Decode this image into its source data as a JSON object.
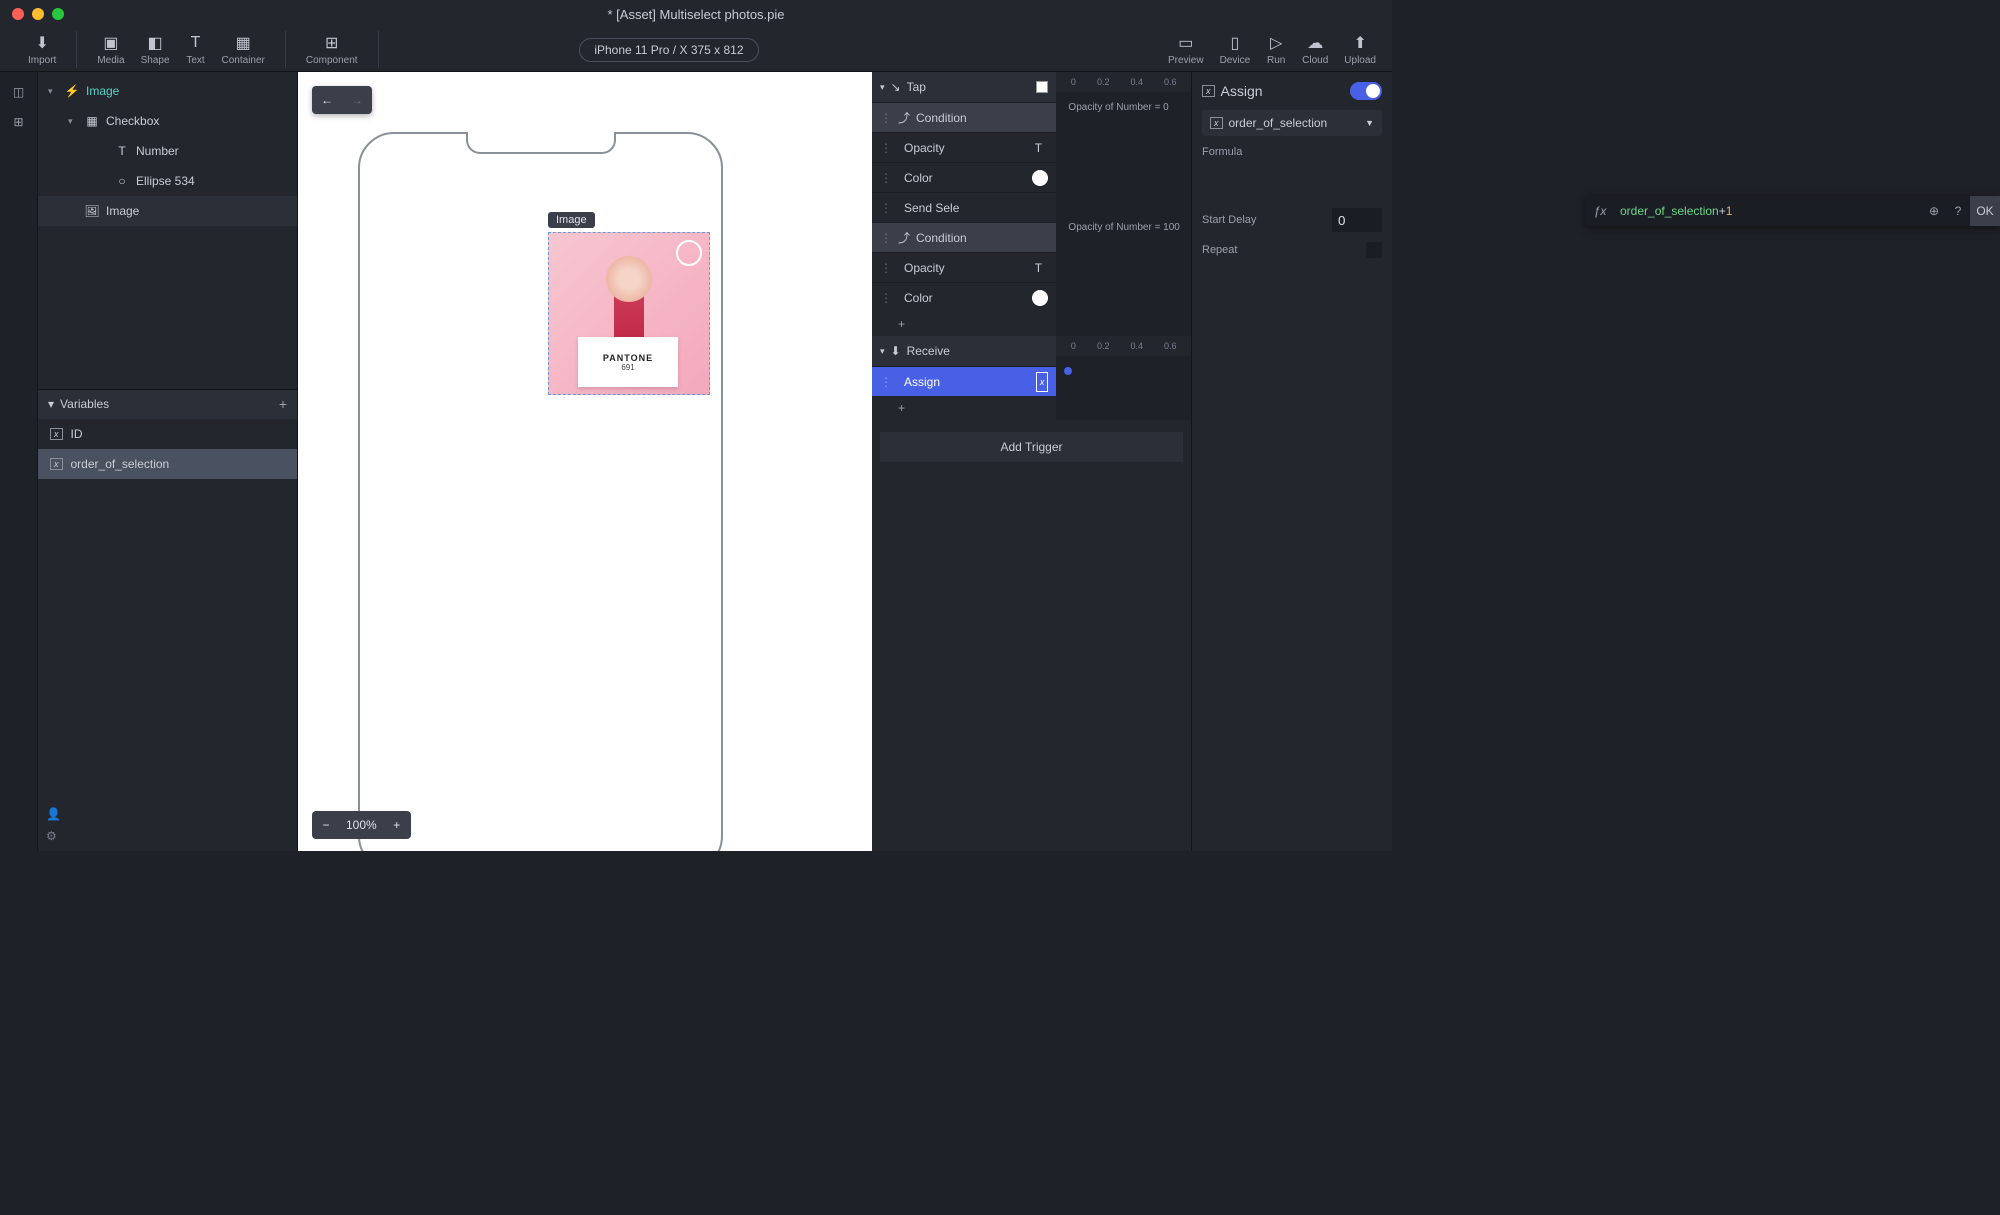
{
  "titlebar": {
    "title": "* [Asset] Multiselect photos.pie"
  },
  "toolbar": {
    "import": "Import",
    "media": "Media",
    "shape": "Shape",
    "text": "Text",
    "container": "Container",
    "component": "Component",
    "device_pill": "iPhone 11 Pro / X  375 x 812",
    "preview": "Preview",
    "device": "Device",
    "run": "Run",
    "cloud": "Cloud",
    "upload": "Upload"
  },
  "tree": {
    "items": [
      {
        "label": "Image",
        "icon": "bolt",
        "level": 0,
        "chev": "▾",
        "accent": true
      },
      {
        "label": "Checkbox",
        "icon": "grid",
        "level": 1,
        "chev": "▾"
      },
      {
        "label": "Number",
        "icon": "T",
        "level": 2
      },
      {
        "label": "Ellipse 534",
        "icon": "circle",
        "level": 2
      },
      {
        "label": "Image",
        "icon": "image",
        "level": 1,
        "selected": true
      }
    ]
  },
  "variables": {
    "header": "Variables",
    "items": [
      {
        "label": "ID"
      },
      {
        "label": "order_of_selection",
        "selected": true
      }
    ]
  },
  "canvas": {
    "selection_label": "Image",
    "brand": "PANTONE",
    "code": "691",
    "zoom": "100%"
  },
  "mid": {
    "triggers": [
      {
        "name": "Tap",
        "ruler": [
          "0",
          "0.2",
          "0.4",
          "0.6"
        ],
        "rows": [
          {
            "kind": "cond",
            "label": "Condition",
            "note": "Opacity of Number = 0"
          },
          {
            "kind": "act",
            "label": "Opacity",
            "tail": "T",
            "slot": true
          },
          {
            "kind": "act",
            "label": "Color",
            "tail": "circle",
            "slot": true
          },
          {
            "kind": "act",
            "label": "Send Sele"
          },
          {
            "kind": "cond",
            "label": "Condition",
            "note": "Opacity of Number = 100"
          },
          {
            "kind": "act",
            "label": "Opacity",
            "tail": "T",
            "slot": true
          },
          {
            "kind": "act",
            "label": "Color",
            "tail": "circle",
            "slot": true
          }
        ]
      },
      {
        "name": "Receive",
        "ruler": [
          "0",
          "0.2",
          "0.4",
          "0.6"
        ],
        "rows": [
          {
            "kind": "assign",
            "label": "Assign",
            "tail": "var",
            "dot": true
          }
        ]
      }
    ],
    "add_trigger": "Add Trigger"
  },
  "right": {
    "title": "Assign",
    "variable": "order_of_selection",
    "formula_label": "Formula",
    "formula_var": "order_of_selection",
    "formula_op": "+",
    "formula_num": "1",
    "ok": "OK",
    "start_delay_label": "Start Delay",
    "start_delay_value": "0",
    "repeat_label": "Repeat"
  }
}
